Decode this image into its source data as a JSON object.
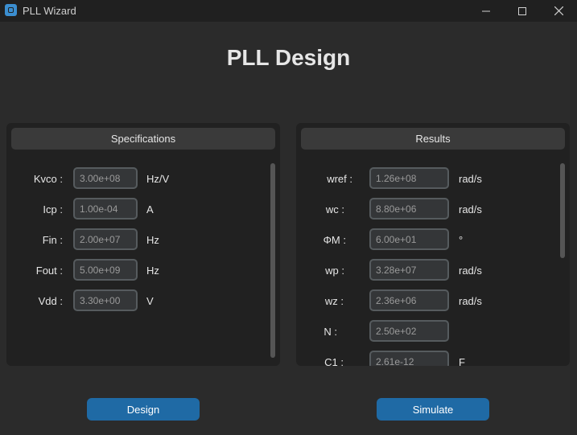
{
  "window": {
    "title": "PLL Wizard"
  },
  "page": {
    "title": "PLL Design"
  },
  "specifications": {
    "header": "Specifications",
    "rows": [
      {
        "label": "Kvco :",
        "value": "3.00e+08",
        "unit": "Hz/V"
      },
      {
        "label": "Icp :",
        "value": "1.00e-04",
        "unit": "A"
      },
      {
        "label": "Fin :",
        "value": "2.00e+07",
        "unit": "Hz"
      },
      {
        "label": "Fout :",
        "value": "5.00e+09",
        "unit": "Hz"
      },
      {
        "label": "Vdd :",
        "value": "3.30e+00",
        "unit": "V"
      }
    ]
  },
  "results": {
    "header": "Results",
    "rows": [
      {
        "label": "wref :",
        "value": "1.26e+08",
        "unit": "rad/s"
      },
      {
        "label": "wc :",
        "value": "8.80e+06",
        "unit": "rad/s"
      },
      {
        "label": "ΦM :",
        "value": "6.00e+01",
        "unit": "°"
      },
      {
        "label": "wp :",
        "value": "3.28e+07",
        "unit": "rad/s"
      },
      {
        "label": "wz :",
        "value": "2.36e+06",
        "unit": "rad/s"
      },
      {
        "label": "N :",
        "value": "2.50e+02",
        "unit": ""
      },
      {
        "label": "C1 :",
        "value": "2.61e-12",
        "unit": "F"
      }
    ]
  },
  "buttons": {
    "design": "Design",
    "simulate": "Simulate"
  },
  "colors": {
    "accent": "#1f6aa5",
    "background": "#2b2b2b",
    "panel": "#212121"
  }
}
